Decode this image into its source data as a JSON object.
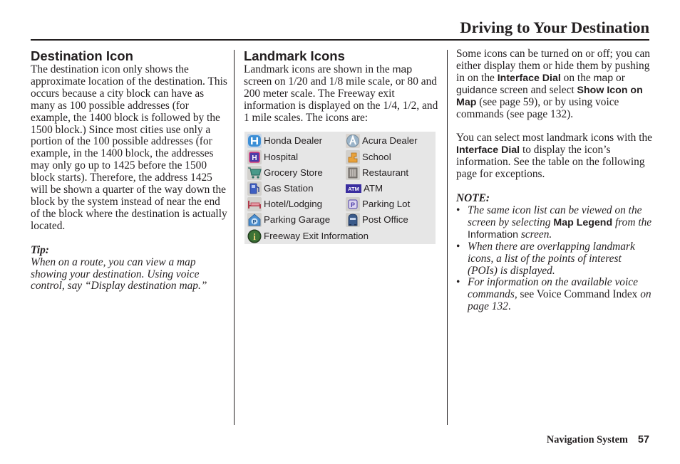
{
  "header": {
    "title": "Driving to Your Destination"
  },
  "destination_icon": {
    "heading": "Destination Icon",
    "body": "The destination icon only shows the approximate location of the destination. This occurs because a city block can have as many as 100 possible addresses (for example, the 1400 block is followed by the 1500 block.) Since most cities use only a portion of the 100 possible addresses (for example, in the 1400 block, the addresses may only go up to 1425 before the 1500 block starts). Therefore, the address 1425 will be shown a quarter of the way down the block by the system instead of near the end of the block where the destination is actually located.",
    "tip_label": "Tip:",
    "tip_text": "When on a route, you can view a map showing your destination. Using voice control, say “Display destination map.”"
  },
  "landmark_icons": {
    "heading": "Landmark Icons",
    "intro_1": "Landmark icons are shown in the ",
    "intro_map": "map",
    "intro_2": " screen on 1/20 and 1/8 mile scale, or 80 and 200 meter scale. The Freeway exit information is displayed on the 1/4, 1/2, and 1 mile scales. The icons are:",
    "icons": [
      {
        "label": "Honda Dealer",
        "icon": "honda-dealer-icon"
      },
      {
        "label": "Acura Dealer",
        "icon": "acura-dealer-icon"
      },
      {
        "label": "Hospital",
        "icon": "hospital-icon"
      },
      {
        "label": "School",
        "icon": "school-icon"
      },
      {
        "label": "Grocery Store",
        "icon": "grocery-store-icon"
      },
      {
        "label": "Restaurant",
        "icon": "restaurant-icon"
      },
      {
        "label": "Gas Station",
        "icon": "gas-station-icon"
      },
      {
        "label": "ATM",
        "icon": "atm-icon"
      },
      {
        "label": "Hotel/Lodging",
        "icon": "hotel-lodging-icon"
      },
      {
        "label": "Parking Lot",
        "icon": "parking-lot-icon"
      },
      {
        "label": "Parking Garage",
        "icon": "parking-garage-icon"
      },
      {
        "label": "Post Office",
        "icon": "post-office-icon"
      },
      {
        "label": "Freeway Exit Information",
        "icon": "freeway-exit-info-icon"
      }
    ],
    "atm_glyph": "ATM",
    "hospital_glyph": "H",
    "parking_glyph": "P",
    "info_glyph": "i"
  },
  "right_column": {
    "p1_a": "Some icons can be turned on or off; you can either display them or hide them by pushing in on the ",
    "p1_interface_dial": "Interface Dial",
    "p1_b": " on the ",
    "p1_map": "map",
    "p1_c": " or ",
    "p1_guidance": "guidance",
    "p1_d": " screen and select ",
    "p1_show_icon": "Show Icon on Map",
    "p1_e": " (see page 59), or by using voice commands (see page 132).",
    "p2_a": "You can select most landmark icons with the ",
    "p2_interface_dial": "Interface Dial",
    "p2_b": " to display the icon’s information. See the table on the following page for exceptions.",
    "note_label": "NOTE:",
    "notes": [
      {
        "a": "The same icon list can be viewed on the screen by selecting ",
        "bold": "Map Legend",
        "b": " from the ",
        "ui": "Information",
        "c": " screen."
      },
      {
        "a": "When there are overlapping landmark icons, a list of the points of interest (POIs) is displayed."
      },
      {
        "a": "For information on the available voice commands,",
        "b": " see Voice Command Index ",
        "c": "on page 132",
        "d": "."
      }
    ]
  },
  "footer": {
    "section": "Navigation System",
    "page_number": "57"
  }
}
